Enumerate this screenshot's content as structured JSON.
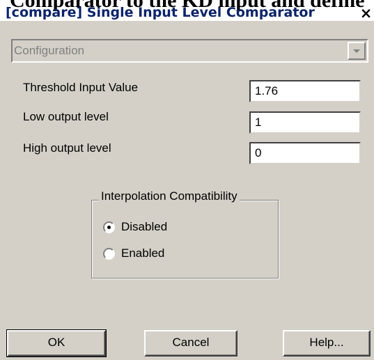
{
  "background_text": "Comparator to the KD input and define",
  "window": {
    "title": "[compare] Single Input Level Comparator",
    "close_glyph": "×"
  },
  "config": {
    "value": "Configuration"
  },
  "params": [
    {
      "label": "Threshold Input Value",
      "value": "1.76"
    },
    {
      "label": "Low output level",
      "value": "1"
    },
    {
      "label": "High output level",
      "value": "0"
    }
  ],
  "interpolation": {
    "legend": "Interpolation Compatibility",
    "options": [
      {
        "label": "Disabled",
        "selected": true
      },
      {
        "label": "Enabled",
        "selected": false
      }
    ]
  },
  "buttons": {
    "ok": "OK",
    "cancel": "Cancel",
    "help": "Help..."
  }
}
